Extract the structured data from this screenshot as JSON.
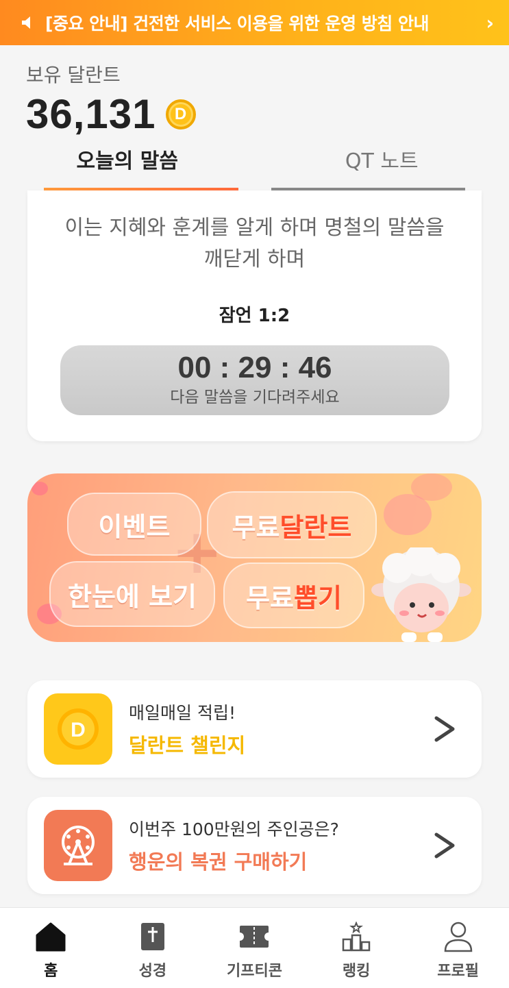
{
  "notice": {
    "text": "[중요 안내] 건전한 서비스 이용을 위한 운영 방침 안내",
    "icon": "speaker-icon",
    "chevron": "›"
  },
  "balance": {
    "label": "보유 달란트",
    "amount": "36,131",
    "coin_letter": "D"
  },
  "tabs": [
    {
      "label": "오늘의 말씀",
      "active": true
    },
    {
      "label": "QT 노트",
      "active": false
    }
  ],
  "verse": {
    "text": "이는 지혜와 훈계를 알게 하며 명철의 말씀을 깨닫게 하며",
    "reference": "잠언 1:2",
    "timer": "00 : 29 : 46",
    "timer_caption": "다음 말씀을 기다려주세요"
  },
  "banner": {
    "pill1": "이벤트",
    "pill2_a": "무료",
    "pill2_b": "달란트",
    "pill3": "한눈에 보기",
    "pill4_a": "무료",
    "pill4_b": "뽑기",
    "plus": "+"
  },
  "cards": [
    {
      "line1": "매일매일 적립!",
      "line2": "달란트 챌린지",
      "color": "#f5b800",
      "icon": "coin-icon",
      "icon_letter": "D"
    },
    {
      "line1": "이번주 100만원의 주인공은?",
      "line2": "행운의 복권 구매하기",
      "color": "#f27a55",
      "icon": "ferris-wheel-icon"
    }
  ],
  "nav": [
    {
      "label": "홈",
      "icon": "home-icon",
      "active": true
    },
    {
      "label": "성경",
      "icon": "bible-icon",
      "active": false
    },
    {
      "label": "기프티콘",
      "icon": "ticket-icon",
      "active": false
    },
    {
      "label": "랭킹",
      "icon": "ranking-icon",
      "active": false
    },
    {
      "label": "프로필",
      "icon": "profile-icon",
      "active": false
    }
  ],
  "colors": {
    "accent": "#ff8a1f",
    "challenge": "#f5b800",
    "lottery": "#f27a55"
  }
}
